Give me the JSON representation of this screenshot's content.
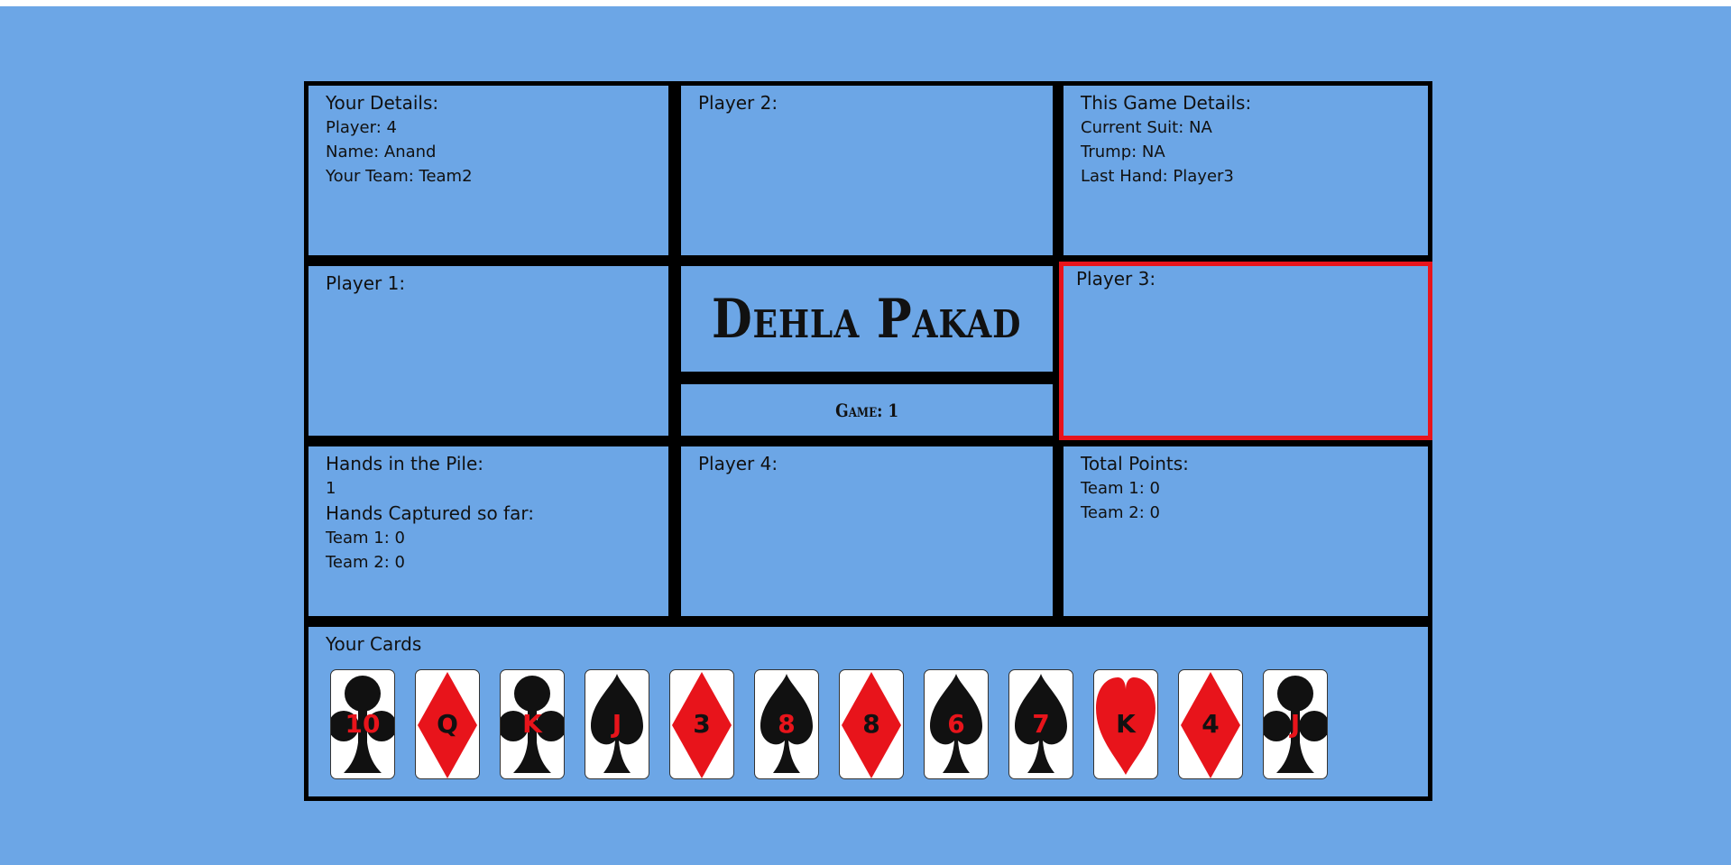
{
  "game_title": "Dehla Pakad",
  "game_number": "Game: 1",
  "your_details": {
    "heading": "Your Details:",
    "player": "Player: 4",
    "name": "Name: Anand",
    "team": "Your Team: Team2"
  },
  "player2": {
    "heading": "Player 2:"
  },
  "player1": {
    "heading": "Player 1:"
  },
  "player3": {
    "heading": "Player 3:",
    "active": true
  },
  "player4": {
    "heading": "Player 4:"
  },
  "game_details": {
    "heading": "This Game Details:",
    "current_suit": "Current Suit: NA",
    "trump": "Trump: NA",
    "last_hand": "Last Hand: Player3"
  },
  "pile": {
    "heading": "Hands in the Pile:",
    "count": "1",
    "captured_heading": "Hands Captured so far:",
    "team1": "Team 1: 0",
    "team2": "Team 2: 0"
  },
  "points": {
    "heading": "Total Points:",
    "team1": "Team 1: 0",
    "team2": "Team 2: 0"
  },
  "your_cards": {
    "heading": "Your Cards",
    "cards": [
      {
        "rank": "10",
        "suit": "clubs"
      },
      {
        "rank": "Q",
        "suit": "diamonds"
      },
      {
        "rank": "K",
        "suit": "clubs"
      },
      {
        "rank": "J",
        "suit": "spades"
      },
      {
        "rank": "3",
        "suit": "diamonds"
      },
      {
        "rank": "8",
        "suit": "spades"
      },
      {
        "rank": "8",
        "suit": "diamonds"
      },
      {
        "rank": "6",
        "suit": "spades"
      },
      {
        "rank": "7",
        "suit": "spades"
      },
      {
        "rank": "K",
        "suit": "hearts"
      },
      {
        "rank": "4",
        "suit": "diamonds"
      },
      {
        "rank": "J",
        "suit": "clubs"
      }
    ]
  },
  "colors": {
    "table_bg": "#6ca6e6",
    "active_border": "#e8141b",
    "red_suit": "#e8141b",
    "black_suit": "#111111",
    "red_rank_on_black": "#e8141b",
    "black_rank_on_red": "#111111"
  }
}
